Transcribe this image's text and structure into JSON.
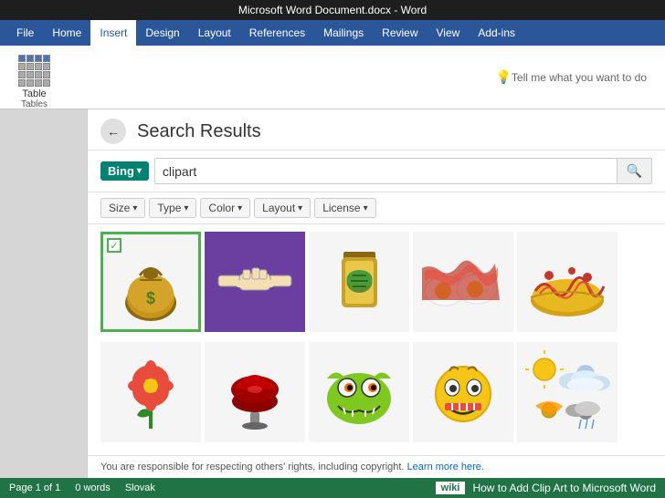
{
  "titlebar": {
    "text": "Microsoft Word Document.docx - Word"
  },
  "ribbon": {
    "tabs": [
      "File",
      "Home",
      "Insert",
      "Design",
      "Layout",
      "References",
      "Mailings",
      "Review",
      "View",
      "Add-ins"
    ],
    "active_tab": "Insert",
    "table_label": "Table",
    "tables_group": "Tables",
    "tell_me": "Tell me what you want to do"
  },
  "search_panel": {
    "title": "Search Results",
    "back_label": "←",
    "bing_label": "Bing",
    "search_value": "clipart",
    "search_placeholder": "Search",
    "filters": [
      "Size",
      "Type",
      "Color",
      "Layout",
      "License"
    ],
    "copyright": "You are responsible for respecting others' rights, including copyright.",
    "learn_more": "Learn more here."
  },
  "statusbar": {
    "page": "Page 1 of 1",
    "words": "0 words",
    "language": "Slovak",
    "wiki_badge": "wiki",
    "how_to": "How to Add Clip Art to Microsoft Word"
  }
}
